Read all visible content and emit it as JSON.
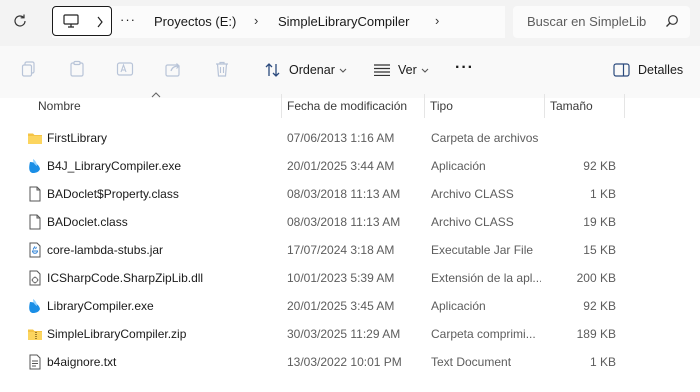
{
  "address_bar": {
    "refresh_icon": "refresh-icon",
    "device_icon": "monitor-icon",
    "overflow": "···",
    "breadcrumbs": [
      "Proyectos (E:)",
      "SimpleLibraryCompiler"
    ],
    "search_placeholder": "Buscar en SimpleLib"
  },
  "toolbar": {
    "icons": [
      "cut-icon",
      "copy-icon",
      "rename-icon",
      "share-icon",
      "delete-icon"
    ],
    "sort_label": "Ordenar",
    "view_label": "Ver",
    "more_label": "···",
    "details_label": "Detalles"
  },
  "columns": {
    "name": "Nombre",
    "date": "Fecha de modificación",
    "type": "Tipo",
    "size": "Tamaño"
  },
  "files": [
    {
      "name": "FirstLibrary",
      "date": "07/06/2013 1:16 AM",
      "type": "Carpeta de archivos",
      "size": "",
      "icon": "folder-icon"
    },
    {
      "name": "B4J_LibraryCompiler.exe",
      "date": "20/01/2025 3:44 AM",
      "type": "Aplicación",
      "size": "92 KB",
      "icon": "app-icon"
    },
    {
      "name": "BADoclet$Property.class",
      "date": "08/03/2018 11:13 AM",
      "type": "Archivo CLASS",
      "size": "1 KB",
      "icon": "file-icon"
    },
    {
      "name": "BADoclet.class",
      "date": "08/03/2018 11:13 AM",
      "type": "Archivo CLASS",
      "size": "19 KB",
      "icon": "file-icon"
    },
    {
      "name": "core-lambda-stubs.jar",
      "date": "17/07/2024 3:18 AM",
      "type": "Executable Jar File",
      "size": "15 KB",
      "icon": "jar-icon"
    },
    {
      "name": "ICSharpCode.SharpZipLib.dll",
      "date": "10/01/2023 5:39 AM",
      "type": "Extensión de la apl...",
      "size": "200 KB",
      "icon": "dll-icon"
    },
    {
      "name": "LibraryCompiler.exe",
      "date": "20/01/2025 3:45 AM",
      "type": "Aplicación",
      "size": "92 KB",
      "icon": "app-icon"
    },
    {
      "name": "SimpleLibraryCompiler.zip",
      "date": "30/03/2025 11:29 AM",
      "type": "Carpeta comprimi...",
      "size": "189 KB",
      "icon": "zip-icon"
    },
    {
      "name": "b4aignore.txt",
      "date": "13/03/2022 10:01 PM",
      "type": "Text Document",
      "size": "1 KB",
      "icon": "text-file-icon"
    }
  ]
}
